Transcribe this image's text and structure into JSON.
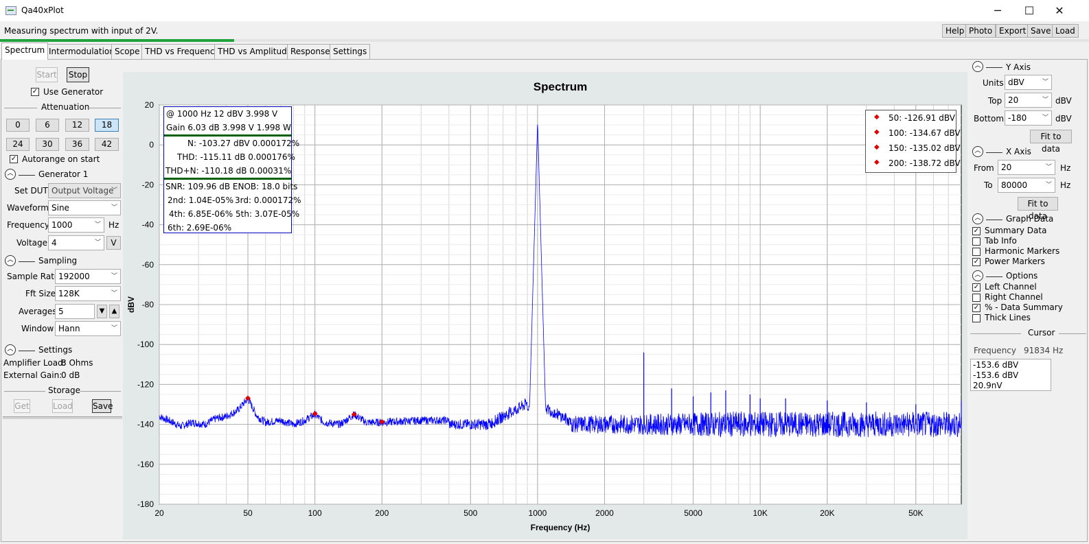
{
  "window": {
    "title": "Qa40xPlot",
    "minimize": "─",
    "maximize": "☐",
    "close": "✕"
  },
  "status": {
    "text": "Measuring spectrum with input of 2V.",
    "progress": 0.215
  },
  "toolbar": {
    "help": "Help",
    "photo": "Photo",
    "export": "Export",
    "save": "Save",
    "load": "Load"
  },
  "tabs": [
    "Spectrum",
    "Intermodulation",
    "Scope",
    "THD vs Frequency",
    "THD vs Amplitude",
    "Response",
    "Settings"
  ],
  "left": {
    "start": "Start",
    "stop": "Stop",
    "use_generator": "Use Generator",
    "attenuation": {
      "title": "Attenuation",
      "values": [
        "0",
        "6",
        "12",
        "18",
        "24",
        "30",
        "36",
        "42"
      ],
      "selected": "18"
    },
    "autorange": "Autorange on start",
    "generator": {
      "title": "Generator 1",
      "set_dut_label": "Set DUT",
      "set_dut_value": "Output Voltage",
      "waveform_label": "Waveform",
      "waveform_value": "Sine",
      "frequency_label": "Frequency",
      "frequency_value": "1000",
      "frequency_unit": "Hz",
      "voltage_label": "Voltage",
      "voltage_value": "4",
      "voltage_unit": "V"
    },
    "sampling": {
      "title": "Sampling",
      "sample_rate_label": "Sample Rate",
      "sample_rate_value": "192000",
      "fft_label": "Fft Size",
      "fft_value": "128K",
      "averages_label": "Averages",
      "averages_value": "5",
      "window_label": "Window",
      "window_value": "Hann"
    },
    "settings": {
      "title": "Settings",
      "load_label": "Amplifier Load:",
      "load_value": "8 Ohms",
      "gain_label": "External Gain:",
      "gain_value": "0 dB"
    },
    "storage": {
      "title": "Storage",
      "get": "Get",
      "load": "Load",
      "save": "Save"
    }
  },
  "right": {
    "yaxis": {
      "title": "Y Axis",
      "units_label": "Units",
      "units_value": "dBV",
      "top_label": "Top",
      "top_value": "20",
      "top_unit": "dBV",
      "bottom_label": "Bottom",
      "bottom_value": "-180",
      "bottom_unit": "dBV",
      "fit": "Fit to data"
    },
    "xaxis": {
      "title": "X Axis",
      "from_label": "From",
      "from_value": "20",
      "from_unit": "Hz",
      "to_label": "To",
      "to_value": "80000",
      "to_unit": "Hz",
      "fit": "Fit to data"
    },
    "graph_data": {
      "title": "Graph Data",
      "items": [
        {
          "label": "Summary Data",
          "checked": true
        },
        {
          "label": "Tab Info",
          "checked": false
        },
        {
          "label": "Harmonic Markers",
          "checked": false
        },
        {
          "label": "Power Markers",
          "checked": true
        }
      ]
    },
    "options": {
      "title": "Options",
      "items": [
        {
          "label": "Left Channel",
          "checked": true
        },
        {
          "label": "Right Channel",
          "checked": false
        },
        {
          "label": "% - Data Summary",
          "checked": true
        },
        {
          "label": "Thick Lines",
          "checked": false
        }
      ]
    },
    "cursor": {
      "title": "Cursor",
      "freq_label": "Frequency",
      "freq_value": "91834 Hz",
      "lines": [
        "-153.6 dBV",
        "-153.6 dBV",
        "20.9nV"
      ]
    }
  },
  "summary": {
    "line1": "@ 1000 Hz    12 dBV  3.998 V",
    "line2": "Gain 6.03 dB  3.998 V  1.998 W",
    "n": "N: -103.27 dBV  0.000172%",
    "thd": "THD: -115.11 dB    0.000176%",
    "thdn": "THD+N: -110.18 dB    0.00031%",
    "snr": "SNR: 109.96 dB   ENOB: 18.0 bits",
    "h2": "2nd: 1.04E-05%",
    "h3": "3rd: 0.000172%",
    "h4": "4th: 6.85E-06%",
    "h5": "5th: 3.07E-05%",
    "h6": "6th: 2.69E-06%"
  },
  "markers_legend": [
    "50: -126.91 dBV",
    "100: -134.67 dBV",
    "150: -135.02 dBV",
    "200: -138.72 dBV"
  ],
  "colors": {
    "trace": "#0000ff",
    "marker": "#e00000",
    "plot_bg": "#ffffff",
    "area_bg": "#e3e8e8",
    "progress": "#1fa33a",
    "summary_border": "#0000c0",
    "summary_rule": "#006000"
  },
  "chart_data": {
    "type": "line",
    "title": "Spectrum",
    "xlabel": "Frequency (Hz)",
    "ylabel": "dBV",
    "xscale": "log",
    "xlim": [
      20,
      80000
    ],
    "ylim": [
      -180,
      20
    ],
    "xticks": [
      20,
      50,
      100,
      200,
      500,
      1000,
      2000,
      5000,
      10000,
      20000,
      50000
    ],
    "xtick_labels": [
      "20",
      "50",
      "100",
      "200",
      "500",
      "1000",
      "2000",
      "5000",
      "10K",
      "20K",
      "50K"
    ],
    "yticks": [
      20,
      0,
      -20,
      -40,
      -60,
      -80,
      -100,
      -120,
      -140,
      -160,
      -180
    ],
    "grid": true,
    "noise_floor_dbv": -140,
    "series": [
      {
        "points": [
          [
            20,
            -136
          ],
          [
            22,
            -138
          ],
          [
            25,
            -141
          ],
          [
            28,
            -139
          ],
          [
            32,
            -140
          ],
          [
            36,
            -137
          ],
          [
            40,
            -136
          ],
          [
            45,
            -133
          ],
          [
            50,
            -127
          ],
          [
            55,
            -136
          ],
          [
            60,
            -139
          ],
          [
            70,
            -138
          ],
          [
            80,
            -140
          ],
          [
            90,
            -138
          ],
          [
            100,
            -135
          ],
          [
            110,
            -139
          ],
          [
            130,
            -140
          ],
          [
            150,
            -135
          ],
          [
            170,
            -139
          ],
          [
            200,
            -139
          ],
          [
            300,
            -138
          ],
          [
            500,
            -138
          ],
          [
            700,
            -136
          ],
          [
            850,
            -133
          ],
          [
            950,
            -127
          ],
          [
            980,
            -110
          ],
          [
            1000,
            12
          ],
          [
            1020,
            -110
          ],
          [
            1050,
            -127
          ],
          [
            1150,
            -136
          ],
          [
            1500,
            -140
          ],
          [
            2000,
            -140
          ],
          [
            3000,
            -104
          ],
          [
            4000,
            -122
          ],
          [
            5000,
            -126
          ],
          [
            6000,
            -124
          ],
          [
            7000,
            -123
          ],
          [
            9000,
            -125
          ],
          [
            10000,
            -127
          ],
          [
            13000,
            -127
          ],
          [
            20000,
            -128
          ],
          [
            30000,
            -129
          ],
          [
            50000,
            -130
          ],
          [
            80000,
            -128
          ]
        ]
      }
    ],
    "markers": [
      {
        "x": 50,
        "y": -126.91
      },
      {
        "x": 100,
        "y": -134.67
      },
      {
        "x": 150,
        "y": -135.02
      },
      {
        "x": 200,
        "y": -138.72
      }
    ]
  }
}
